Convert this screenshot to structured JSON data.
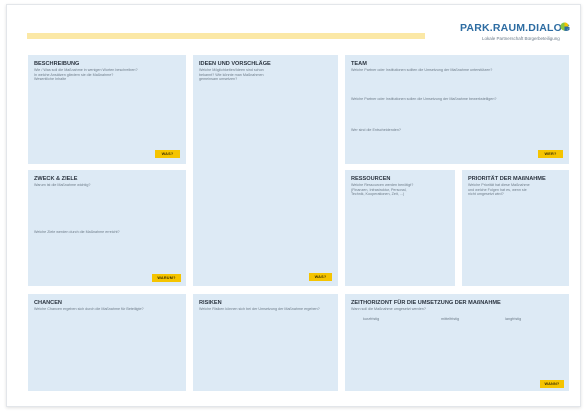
{
  "logo": {
    "title": "PARK.RAUM.DIALOG",
    "subtitle": "Lokale Partnerschaft Bürgerbeteiligung",
    "dot_colors": [
      "#8cc63f",
      "#f5c400",
      "#2d6ca2"
    ]
  },
  "colors": {
    "box": "#ddeaf5",
    "tag": "#f5c400",
    "band": "#fbe8a6",
    "brand": "#2d6ca2"
  },
  "boxes": {
    "beschreibung": {
      "title": "BESCHREIBUNG",
      "lines": [
        "Wie / Was soll die Maßnahme in wenigen Worten beschreiben?",
        "In welche Ansätzen gliedern sie die Maßnahme?",
        "Wesentliche Inhalte"
      ],
      "tag": "WAS?"
    },
    "ideen": {
      "title": "IDEEN UND VORSCHLÄGE",
      "lines": [
        "Welche Möglichkeiten/Ideen sind schon",
        "bekannt? Wie könnte man Maßnahmen",
        "gemeinsam umsetzen?"
      ],
      "tag": "WAS?"
    },
    "team": {
      "title": "TEAM",
      "line1": "Welche Partner oder Institutionen sollten die Umsetzung der Maßnahme unterstützen?",
      "line2": "Welche Partner oder Institutionen sollen die Umsetzung der Maßnahme bewerkstelligen?",
      "line3": "Wer sind die Entscheidenden?",
      "tag": "WER?"
    },
    "zweck": {
      "title": "ZWECK & ZIELE",
      "line1": "Warum ist die Maßnahme wichtig?",
      "line2": "Welche Ziele werden durch die Maßnahme erreicht?",
      "tag": "WARUM?"
    },
    "ressourcen": {
      "title": "RESSOURCEN",
      "lines": [
        "Welche Ressourcen werden benötigt?",
        "(Finanzen, Infrastruktur, Personal,",
        "Technik, Kooperationen, Zeit, ...)"
      ]
    },
    "prioritaet": {
      "title": "PRIORITÄT DER MAßNAHME",
      "lines": [
        "Welche Priorität hat diese Maßnahme",
        "und welche Folgen hat es, wenn sie",
        "nicht umgesetzt wird?"
      ]
    },
    "chancen": {
      "title": "CHANCEN",
      "line1": "Welche Chancen ergeben sich durch die Maßnahme für Beteiligte?"
    },
    "risiken": {
      "title": "RISIKEN",
      "line1": "Welche Risiken können sich bei der Umsetzung der Maßnahme ergeben?"
    },
    "zeithorizont": {
      "title": "ZEITHORIZONT FÜR DIE UMSETZUNG DER MAßNAHME",
      "line1": "Wann soll die Maßnahme umgesetzt werden?",
      "columns": [
        "kurzfristig",
        "mittelfristig",
        "langfristig"
      ],
      "tag": "WANN?"
    }
  },
  "zweck_tag": "WARUM?"
}
